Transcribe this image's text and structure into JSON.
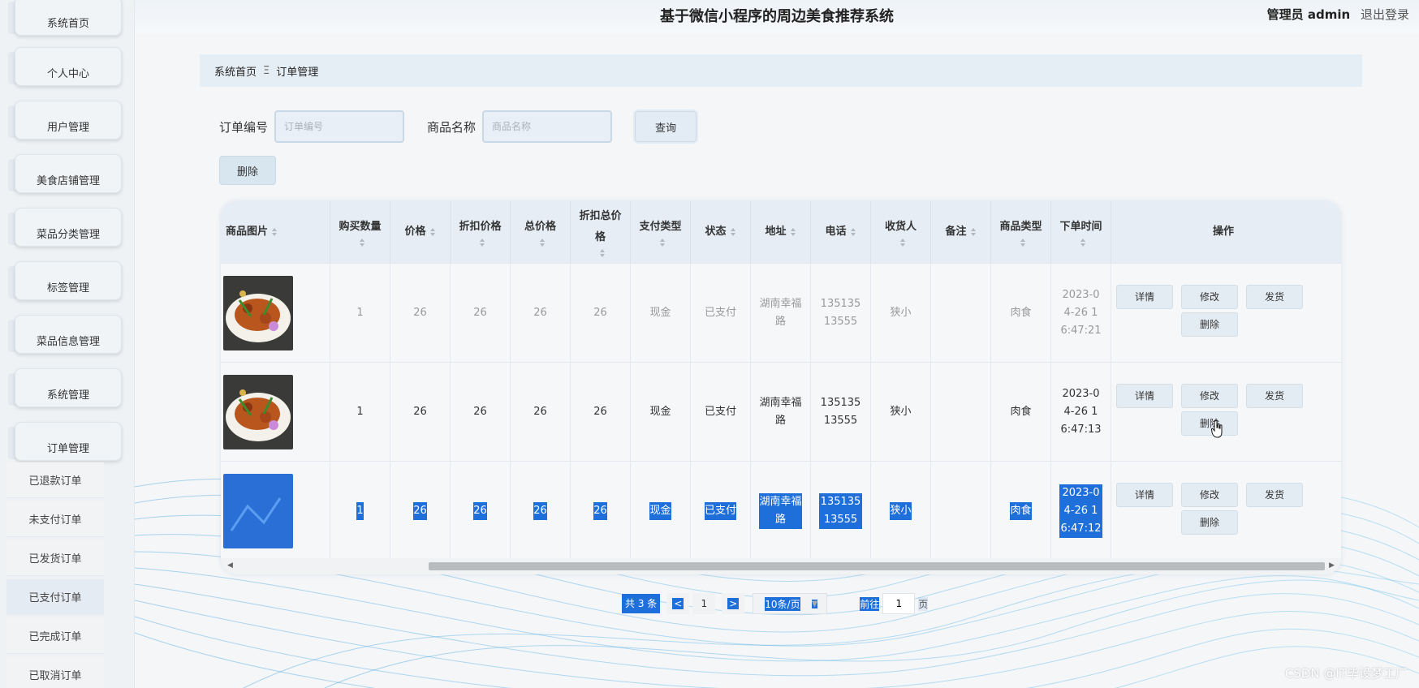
{
  "header": {
    "title": "基于微信小程序的周边美食推荐系统",
    "role_label": "管理员 admin",
    "logout": "退出登录"
  },
  "sidebar": {
    "items": [
      {
        "label": "系统首页"
      },
      {
        "label": "个人中心"
      },
      {
        "label": "用户管理"
      },
      {
        "label": "美食店铺管理"
      },
      {
        "label": "菜品分类管理"
      },
      {
        "label": "标签管理"
      },
      {
        "label": "菜品信息管理"
      },
      {
        "label": "系统管理"
      },
      {
        "label": "订单管理"
      }
    ],
    "submenu": [
      {
        "label": "已退款订单"
      },
      {
        "label": "未支付订单"
      },
      {
        "label": "已发货订单"
      },
      {
        "label": "已支付订单"
      },
      {
        "label": "已完成订单"
      },
      {
        "label": "已取消订单"
      }
    ]
  },
  "breadcrumb": {
    "home": "系统首页",
    "separator": "Ξ",
    "current": "订单管理"
  },
  "search": {
    "order_label": "订单编号",
    "order_placeholder": "订单编号",
    "product_label": "商品名称",
    "product_placeholder": "商品名称",
    "query_button": "查询"
  },
  "toolbar": {
    "delete_button": "删除"
  },
  "table": {
    "headers": {
      "image": "商品图片",
      "qty": "购买数量",
      "price": "价格",
      "discount": "折扣价格",
      "total": "总价格",
      "discount_total": "折扣总价格",
      "pay_type": "支付类型",
      "status": "状态",
      "address": "地址",
      "phone": "电话",
      "receiver": "收货人",
      "note": "备注",
      "category": "商品类型",
      "order_time": "下单时间",
      "actions": "操作"
    },
    "rows": [
      {
        "qty": "1",
        "price": "26",
        "discount": "26",
        "total": "26",
        "discount_total": "26",
        "pay_type": "现金",
        "status": "已支付",
        "address": "湖南幸福路",
        "phone": "13513513555",
        "receiver": "狭小",
        "note": "",
        "category": "肉食",
        "order_time": "2023-04-26 16:47:21"
      },
      {
        "qty": "1",
        "price": "26",
        "discount": "26",
        "total": "26",
        "discount_total": "26",
        "pay_type": "现金",
        "status": "已支付",
        "address": "湖南幸福路",
        "phone": "13513513555",
        "receiver": "狭小",
        "note": "",
        "category": "肉食",
        "order_time": "2023-04-26 16:47:13"
      },
      {
        "qty": "1",
        "price": "26",
        "discount": "26",
        "total": "26",
        "discount_total": "26",
        "pay_type": "现金",
        "status": "已支付",
        "address": "湖南幸福路",
        "phone": "13513513555",
        "receiver": "狭小",
        "note": "",
        "category": "肉食",
        "order_time": "2023-04-26 16:47:12"
      }
    ],
    "actions": {
      "detail": "详情",
      "edit": "修改",
      "ship": "发货",
      "delete": "删除"
    }
  },
  "pagination": {
    "total": "共 3 条",
    "prev": "<",
    "page": "1",
    "next": ">",
    "page_size": "10条/页",
    "goto": "前往",
    "goto_value": "1",
    "page_suffix": "页"
  },
  "watermark": "CSDN @IT毕设梦工厂",
  "colors": {
    "selection": "#1e6fd9",
    "header_bg": "#e6edf4"
  }
}
